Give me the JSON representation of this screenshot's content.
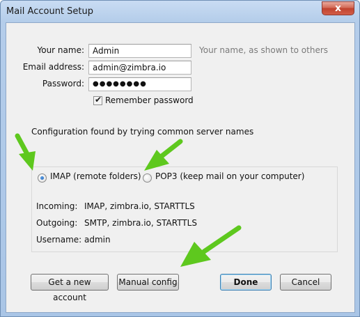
{
  "window": {
    "title": "Mail Account Setup",
    "close_glyph": "x",
    "close_icon": "close-icon"
  },
  "form": {
    "name_label": "Your name:",
    "name_value": "Admin",
    "name_hint": "Your name, as shown to others",
    "email_label": "Email address:",
    "email_value": "admin@zimbra.io",
    "password_label": "Password:",
    "password_value": "●●●●●●●●",
    "remember_label": "Remember password",
    "remember_checked": true
  },
  "config": {
    "status": "Configuration found by trying common server names",
    "imap_label": "IMAP (remote folders)",
    "pop3_label": "POP3 (keep mail on your computer)",
    "selected_protocol": "IMAP",
    "incoming_label": "Incoming:",
    "incoming_value": "IMAP, zimbra.io, STARTTLS",
    "outgoing_label": "Outgoing:",
    "outgoing_value": "SMTP, zimbra.io, STARTTLS",
    "username_label": "Username:",
    "username_value": "admin"
  },
  "buttons": {
    "get_account": "Get a new account",
    "manual_config": "Manual config",
    "done": "Done",
    "cancel": "Cancel"
  },
  "colors": {
    "arrow": "#5ec81e",
    "accent": "#3c7fb1",
    "close": "#c0432f"
  }
}
